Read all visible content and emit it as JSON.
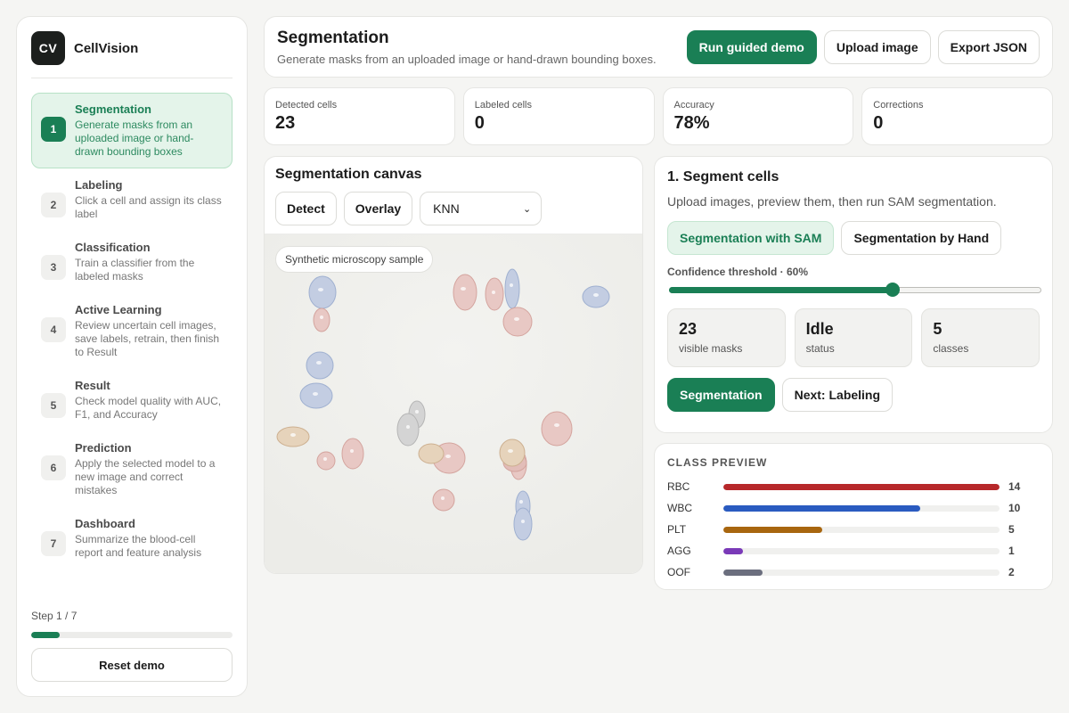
{
  "brand": {
    "logo": "CV",
    "name": "CellVision"
  },
  "steps": [
    {
      "num": "1",
      "title": "Segmentation",
      "desc": "Generate masks from an uploaded image or hand-drawn bounding boxes"
    },
    {
      "num": "2",
      "title": "Labeling",
      "desc": "Click a cell and assign its class label"
    },
    {
      "num": "3",
      "title": "Classification",
      "desc": "Train a classifier from the labeled masks"
    },
    {
      "num": "4",
      "title": "Active Learning",
      "desc": "Review uncertain cell images, save labels, retrain, then finish to Result"
    },
    {
      "num": "5",
      "title": "Result",
      "desc": "Check model quality with AUC, F1, and Accuracy"
    },
    {
      "num": "6",
      "title": "Prediction",
      "desc": "Apply the selected model to a new image and correct mistakes"
    },
    {
      "num": "7",
      "title": "Dashboard",
      "desc": "Summarize the blood-cell report and feature analysis"
    }
  ],
  "sidebar_footer": {
    "step_count": "Step 1 / 7",
    "progress": 0.1428,
    "reset_label": "Reset demo"
  },
  "header": {
    "title": "Segmentation",
    "subtitle": "Generate masks from an uploaded image or hand-drawn bounding boxes.",
    "run_demo": "Run guided demo",
    "upload": "Upload image",
    "export": "Export JSON"
  },
  "stats": [
    {
      "label": "Detected cells",
      "value": "23"
    },
    {
      "label": "Labeled cells",
      "value": "0"
    },
    {
      "label": "Accuracy",
      "value": "78%"
    },
    {
      "label": "Corrections",
      "value": "0"
    }
  ],
  "canvas": {
    "title": "Segmentation canvas",
    "detect": "Detect",
    "overlay": "Overlay",
    "model": "KNN",
    "sample_label": "Synthetic microscopy sample"
  },
  "segment": {
    "title": "1. Segment cells",
    "subtitle": "Upload images, preview them, then run SAM segmentation.",
    "mode_sam": "Segmentation with SAM",
    "mode_hand": "Segmentation by Hand",
    "threshold_label": "Confidence threshold · 60%",
    "threshold": 0.6,
    "minis": [
      {
        "value": "23",
        "label": "visible masks"
      },
      {
        "value": "Idle",
        "label": "status"
      },
      {
        "value": "5",
        "label": "classes"
      }
    ],
    "btn_current": "Segmentation",
    "btn_next": "Next: Labeling"
  },
  "class_preview": {
    "heading": "CLASS PREVIEW",
    "max": 14,
    "classes": [
      {
        "name": "RBC",
        "count": 14,
        "color": "#b7282a"
      },
      {
        "name": "WBC",
        "count": 10,
        "color": "#2a5bc0"
      },
      {
        "name": "PLT",
        "count": 5,
        "color": "#a8660f"
      },
      {
        "name": "AGG",
        "count": 1,
        "color": "#7a3ab8"
      },
      {
        "name": "OOF",
        "count": 2,
        "color": "#6b6e7e"
      }
    ]
  },
  "colors": {
    "accent": "#1a7f55",
    "accent_soft": "#e4f4ea"
  }
}
